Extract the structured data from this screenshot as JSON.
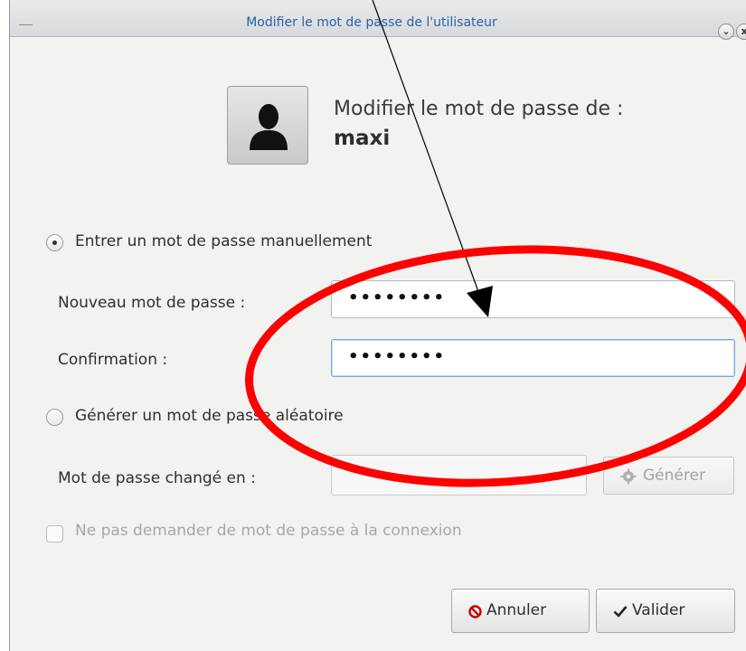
{
  "window": {
    "title": "Modifier le mot de passe de l'utilisateur",
    "minimize_glyph": "⌄",
    "close_glyph": "x"
  },
  "header": {
    "prompt": "Modifier le mot de passe de :",
    "username": "maxi",
    "avatar_icon": "user-silhouette-icon"
  },
  "options": {
    "manual": {
      "label": "Entrer un mot de passe manuellement",
      "selected": true
    },
    "random": {
      "label": "Générer un mot de passe aléatoire",
      "selected": false
    }
  },
  "fields": {
    "new_password": {
      "label": "Nouveau mot de passe :",
      "value": "••••••••"
    },
    "confirmation": {
      "label": "Confirmation :",
      "value": "••••••••"
    },
    "changed_to": {
      "label": "Mot de passe changé en :",
      "value": ""
    }
  },
  "generate_button": {
    "label": "Générer",
    "icon": "gear-icon",
    "enabled": false
  },
  "no_password_checkbox": {
    "label": "Ne pas demander de mot de passe à la connexion",
    "checked": false,
    "enabled": false
  },
  "buttons": {
    "cancel": {
      "label": "Annuler",
      "icon": "cancel-circle-icon"
    },
    "ok": {
      "label": "Valider",
      "icon": "checkmark-icon"
    }
  },
  "annotation": {
    "color": "#ff0000",
    "shapes": [
      "red-ellipse",
      "black-arrow"
    ]
  }
}
